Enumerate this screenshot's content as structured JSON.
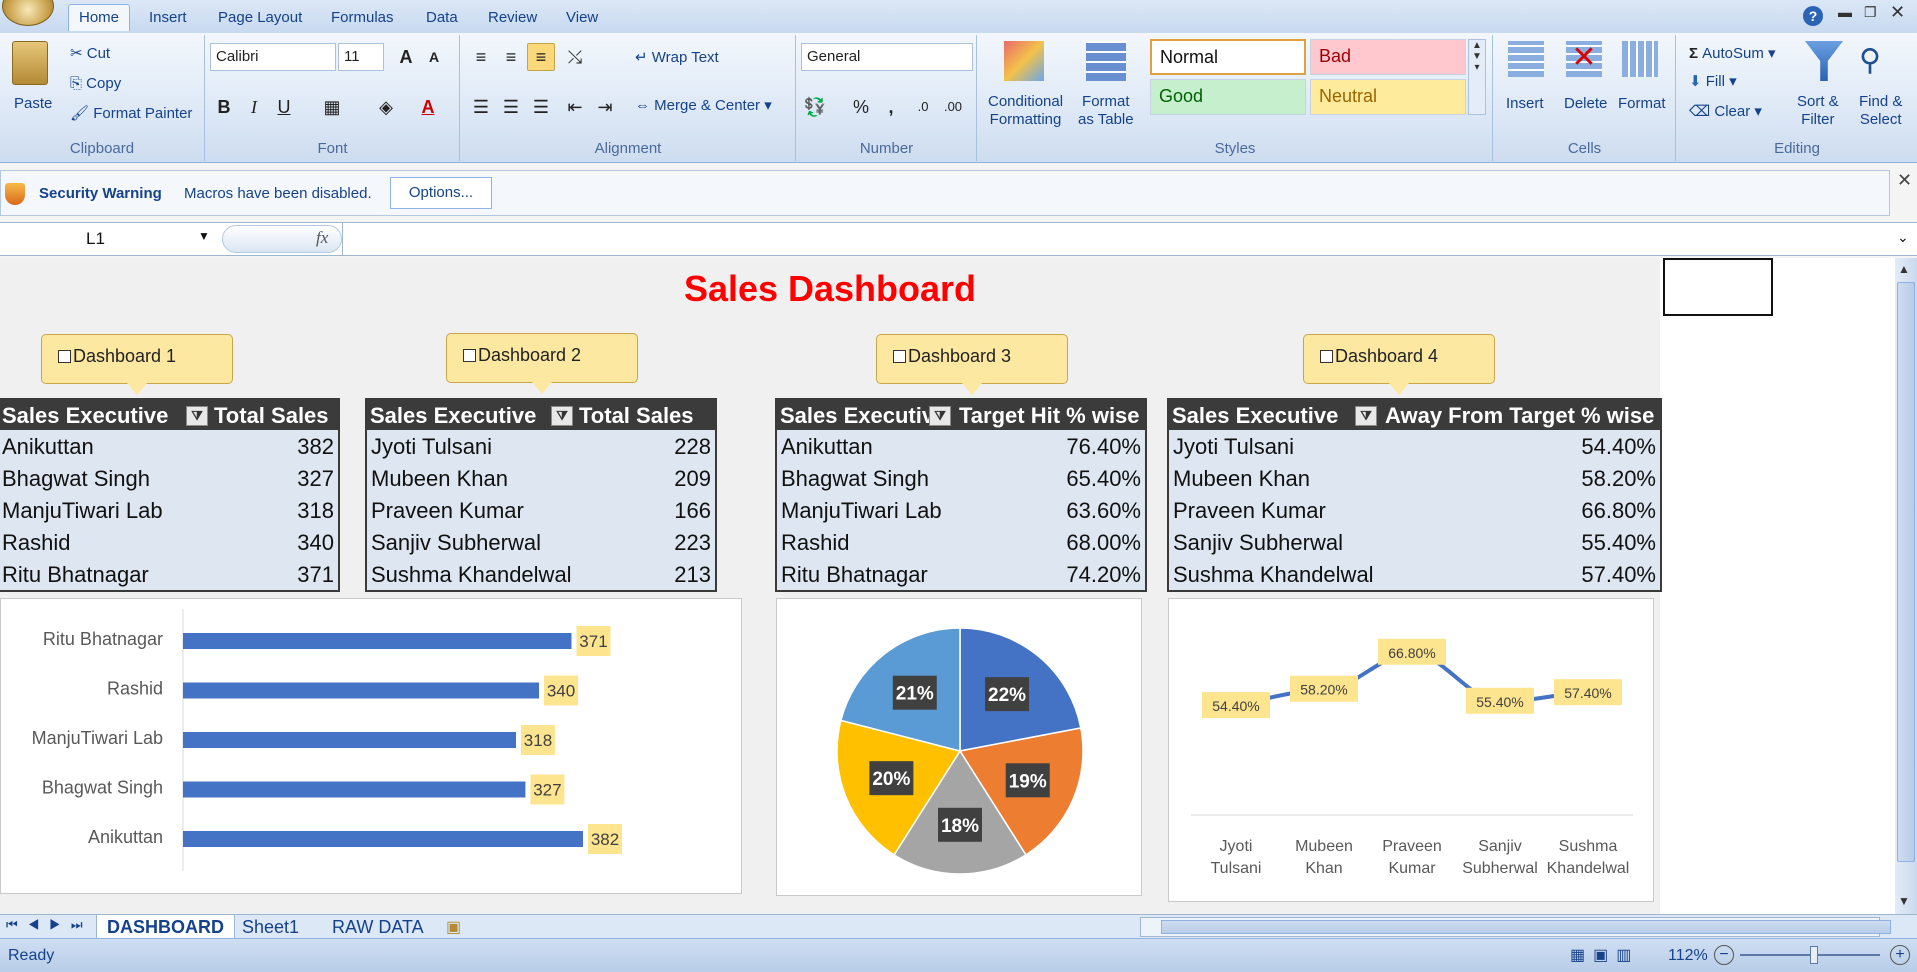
{
  "ribbon": {
    "tabs": [
      "Home",
      "Insert",
      "Page Layout",
      "Formulas",
      "Data",
      "Review",
      "View"
    ],
    "clipboard": {
      "paste": "Paste",
      "cut": "Cut",
      "copy": "Copy",
      "format_painter": "Format Painter",
      "label": "Clipboard"
    },
    "font": {
      "name": "Calibri",
      "size": "11",
      "label": "Font",
      "bold": "B",
      "italic": "I",
      "underline": "U"
    },
    "alignment": {
      "wrap_text": "Wrap Text",
      "merge_center": "Merge & Center",
      "label": "Alignment"
    },
    "number": {
      "format": "General",
      "percent": "%",
      "comma": ",",
      "label": "Number"
    },
    "styles": {
      "conditional": "Conditional",
      "conditional2": "Formatting",
      "format_table": "Format",
      "format_table2": "as Table",
      "normal": "Normal",
      "bad": "Bad",
      "good": "Good",
      "neutral": "Neutral",
      "label": "Styles"
    },
    "cells": {
      "insert": "Insert",
      "delete": "Delete",
      "format": "Format",
      "label": "Cells"
    },
    "editing": {
      "autosum": "AutoSum",
      "fill": "Fill",
      "clear": "Clear",
      "sort": "Sort &",
      "sort2": "Filter",
      "find": "Find &",
      "find2": "Select",
      "label": "Editing"
    }
  },
  "security": {
    "title": "Security Warning",
    "message": "Macros have been disabled.",
    "options": "Options..."
  },
  "formula_bar": {
    "name_box": "L1",
    "fx": "fx",
    "value": ""
  },
  "dashboard": {
    "title": "Sales Dashboard",
    "callouts": [
      "Dashboard 1",
      "Dashboard 2",
      "Dashboard 3",
      "Dashboard 4"
    ],
    "tables": [
      {
        "col1": "Sales Executive",
        "col2": "Total Sales",
        "rows": [
          [
            "Anikuttan",
            "382"
          ],
          [
            "Bhagwat Singh",
            "327"
          ],
          [
            "ManjuTiwari Lab",
            "318"
          ],
          [
            "Rashid",
            "340"
          ],
          [
            "Ritu Bhatnagar",
            "371"
          ]
        ]
      },
      {
        "col1": "Sales Executive",
        "col2": "Total Sales",
        "rows": [
          [
            "Jyoti Tulsani",
            "228"
          ],
          [
            "Mubeen Khan",
            "209"
          ],
          [
            "Praveen Kumar",
            "166"
          ],
          [
            "Sanjiv Subherwal",
            "223"
          ],
          [
            "Sushma Khandelwal",
            "213"
          ]
        ]
      },
      {
        "col1": "Sales Executive",
        "col2": "Target Hit % wise",
        "rows": [
          [
            "Anikuttan",
            "76.40%"
          ],
          [
            "Bhagwat Singh",
            "65.40%"
          ],
          [
            "ManjuTiwari Lab",
            "63.60%"
          ],
          [
            "Rashid",
            "68.00%"
          ],
          [
            "Ritu Bhatnagar",
            "74.20%"
          ]
        ]
      },
      {
        "col1": "Sales Executive",
        "col2": "Away From Target % wise",
        "rows": [
          [
            "Jyoti Tulsani",
            "54.40%"
          ],
          [
            "Mubeen Khan",
            "58.20%"
          ],
          [
            "Praveen Kumar",
            "66.80%"
          ],
          [
            "Sanjiv Subherwal",
            "55.40%"
          ],
          [
            "Sushma Khandelwal",
            "57.40%"
          ]
        ]
      }
    ]
  },
  "chart_data": [
    {
      "type": "bar",
      "orientation": "horizontal",
      "categories": [
        "Ritu Bhatnagar",
        "Rashid",
        "ManjuTiwari Lab",
        "Bhagwat Singh",
        "Anikuttan"
      ],
      "values": [
        371,
        340,
        318,
        327,
        382
      ],
      "data_labels": [
        "371",
        "340",
        "318",
        "327",
        "382"
      ],
      "color": "#4472c4"
    },
    {
      "type": "pie",
      "values": [
        22,
        19,
        18,
        20,
        21
      ],
      "data_labels": [
        "22%",
        "19%",
        "18%",
        "20%",
        "21%"
      ],
      "colors": [
        "#4472c4",
        "#ed7d31",
        "#a5a5a5",
        "#ffc000",
        "#5b9bd5"
      ]
    },
    {
      "type": "line",
      "categories": [
        "Jyoti Tulsani",
        "Mubeen Khan",
        "Praveen Kumar",
        "Sanjiv Subherwal",
        "Sushma Khandelwal"
      ],
      "values": [
        54.4,
        58.2,
        66.8,
        55.4,
        57.4
      ],
      "data_labels": [
        "54.40%",
        "58.20%",
        "66.80%",
        "55.40%",
        "57.40%"
      ],
      "color": "#4472c4"
    }
  ],
  "sheet_tabs": [
    "DASHBOARD",
    "Sheet1",
    "RAW DATA"
  ],
  "status": {
    "ready": "Ready",
    "zoom": "112%"
  }
}
